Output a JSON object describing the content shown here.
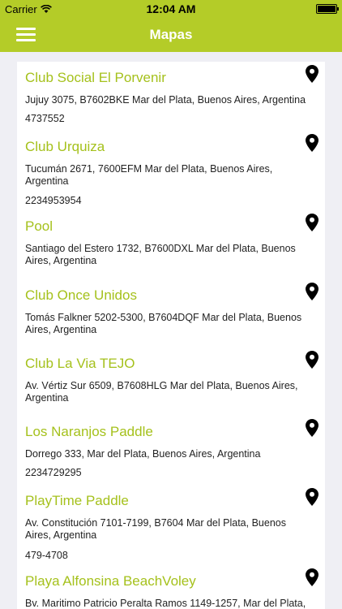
{
  "status": {
    "carrier": "Carrier",
    "time": "12:04 AM"
  },
  "nav": {
    "title": "Mapas",
    "menu_icon": "hamburger-menu-icon"
  },
  "colors": {
    "accent": "#b4cc28",
    "title_text": "#a5c11c"
  },
  "places": [
    {
      "name": "Club Social El Porvenir",
      "address": "Jujuy 3075, B7602BKE Mar del Plata, Buenos Aires, Argentina",
      "phone": "4737552"
    },
    {
      "name": "Club Urquiza",
      "address": "Tucumán 2671, 7600EFM Mar del Plata, Buenos Aires, Argentina",
      "phone": "2234953954"
    },
    {
      "name": "Pool",
      "address": "Santiago del Estero 1732, B7600DXL Mar del Plata, Buenos Aires, Argentina",
      "phone": ""
    },
    {
      "name": "Club Once Unidos",
      "address": "Tomás Falkner 5202-5300, B7604DQF Mar del Plata, Buenos Aires, Argentina",
      "phone": ""
    },
    {
      "name": "Club La Via TEJO",
      "address": "Av. Vértiz Sur 6509, B7608HLG Mar del Plata, Buenos Aires, Argentina",
      "phone": ""
    },
    {
      "name": "Los Naranjos Paddle",
      "address": "Dorrego 333, Mar del Plata, Buenos Aires, Argentina",
      "phone": "2234729295"
    },
    {
      "name": "PlayTime Paddle",
      "address": "Av. Constitución 7101-7199, B7604 Mar del Plata, Buenos Aires, Argentina",
      "phone": "479-4708"
    },
    {
      "name": "Playa Alfonsina BeachVoley",
      "address": "Bv. Maritimo Patricio Peralta Ramos 1149-1257, Mar del Plata,",
      "phone": ""
    }
  ]
}
